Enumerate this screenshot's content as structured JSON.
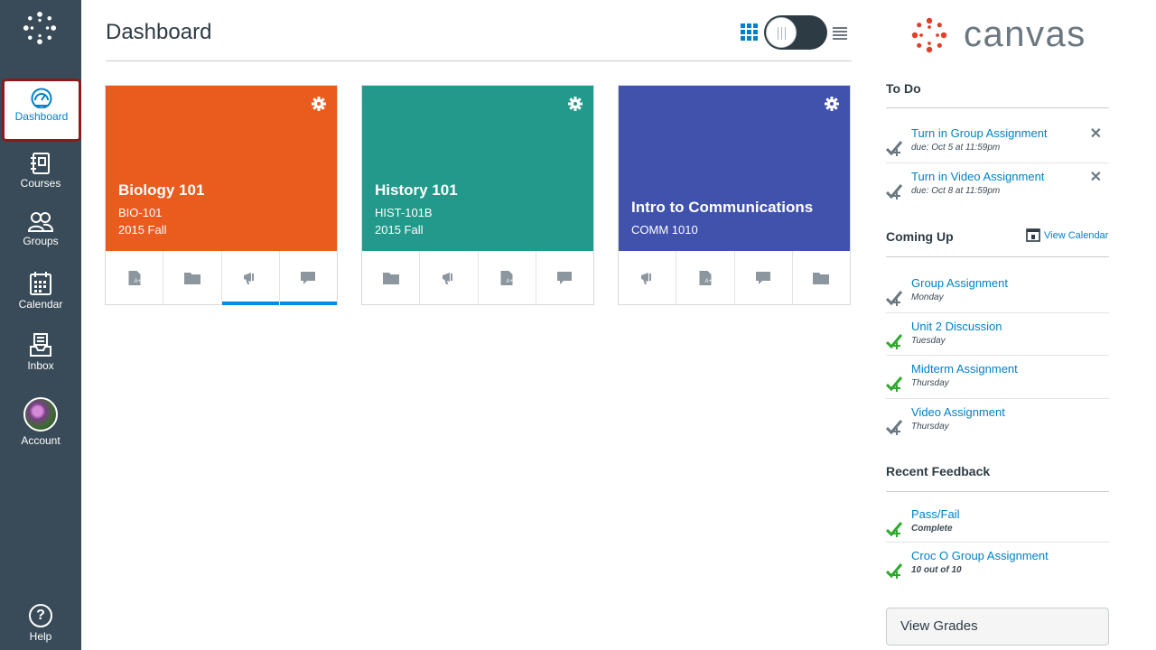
{
  "global_nav": {
    "items": [
      {
        "id": "dashboard",
        "label": "Dashboard",
        "icon": "dashboard-icon"
      },
      {
        "id": "courses",
        "label": "Courses",
        "icon": "courses-icon"
      },
      {
        "id": "groups",
        "label": "Groups",
        "icon": "groups-icon"
      },
      {
        "id": "calendar",
        "label": "Calendar",
        "icon": "calendar-icon"
      },
      {
        "id": "inbox",
        "label": "Inbox",
        "icon": "inbox-icon"
      },
      {
        "id": "account",
        "label": "Account",
        "icon": "avatar"
      },
      {
        "id": "help",
        "label": "Help",
        "icon": "help-icon"
      }
    ],
    "active": "dashboard",
    "active_border_color": "#8b1a1a"
  },
  "header": {
    "title": "Dashboard",
    "view_mode": "card"
  },
  "brand": {
    "wordmark": "canvas",
    "logo_color": "#e13f2b"
  },
  "cards": [
    {
      "title": "Biology 101",
      "code": "BIO-101",
      "term": "2015 Fall",
      "color": "#ea5b1e",
      "actions": [
        "assignments-icon",
        "files-icon",
        "announcements-icon",
        "discussions-icon"
      ],
      "marked_actions": [
        2,
        3
      ]
    },
    {
      "title": "History 101",
      "code": "HIST-101B",
      "term": "2015 Fall",
      "color": "#22998a",
      "actions": [
        "files-icon",
        "announcements-icon",
        "assignments-icon",
        "discussions-icon"
      ],
      "marked_actions": []
    },
    {
      "title": "Intro to Communications",
      "code": "COMM 1010",
      "term": "",
      "color": "#4152ac",
      "actions": [
        "announcements-icon",
        "assignments-icon",
        "discussions-icon",
        "files-icon"
      ],
      "marked_actions": []
    }
  ],
  "sidebar": {
    "todo": {
      "heading": "To Do",
      "items": [
        {
          "title": "Turn in Group Assignment",
          "meta": "due: Oct 5 at 11:59pm"
        },
        {
          "title": "Turn in Video Assignment",
          "meta": "due: Oct 8 at 11:59pm"
        }
      ],
      "dismiss_glyph": "✕"
    },
    "coming_up": {
      "heading": "Coming Up",
      "view_calendar": "View Calendar",
      "items": [
        {
          "title": "Group Assignment",
          "meta": "Monday",
          "status": "gray"
        },
        {
          "title": "Unit 2 Discussion",
          "meta": "Tuesday",
          "status": "green"
        },
        {
          "title": "Midterm Assignment",
          "meta": "Thursday",
          "status": "green"
        },
        {
          "title": "Video Assignment",
          "meta": "Thursday",
          "status": "gray"
        }
      ]
    },
    "recent_feedback": {
      "heading": "Recent Feedback",
      "items": [
        {
          "title": "Pass/Fail",
          "meta": "Complete",
          "status": "green"
        },
        {
          "title": "Croc O Group Assignment",
          "meta": "10 out of 10",
          "status": "green"
        }
      ]
    },
    "view_grades": "View Grades"
  },
  "colors": {
    "nav_bg": "#394b58",
    "link": "#0081c6",
    "check_green": "#2ea92e",
    "check_gray": "#6b7780",
    "marker": "#008ee2"
  }
}
